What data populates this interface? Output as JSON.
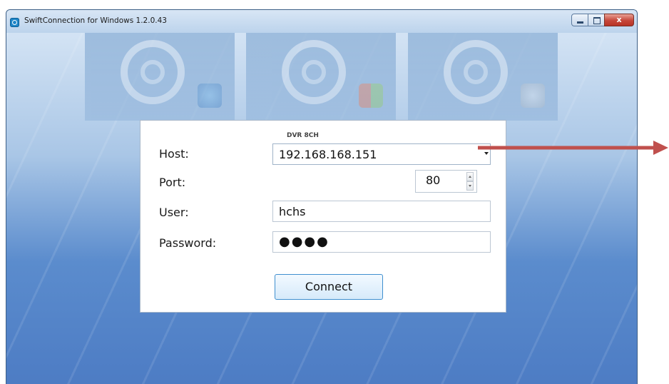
{
  "window": {
    "title": "SwiftConnection for Windows 1.2.0.43",
    "close_glyph": "x"
  },
  "dialog": {
    "profile_name": "DVR 8CH",
    "host": {
      "label": "Host:",
      "value": "192.168.168.151"
    },
    "port": {
      "label": "Port:",
      "value": "80"
    },
    "user": {
      "label": "User:",
      "value": "hchs"
    },
    "password": {
      "label": "Password:",
      "value": "●●●●"
    },
    "connect_label": "Connect"
  },
  "colors": {
    "accent": "#3f8fcf",
    "annotation_arrow": "#c0504d",
    "close_button": "#c6473a"
  },
  "icons": {
    "app": "swiftconnection-app-icon",
    "tiles": [
      "internet-explorer-icon",
      "windows-icon",
      "apple-icon"
    ]
  }
}
